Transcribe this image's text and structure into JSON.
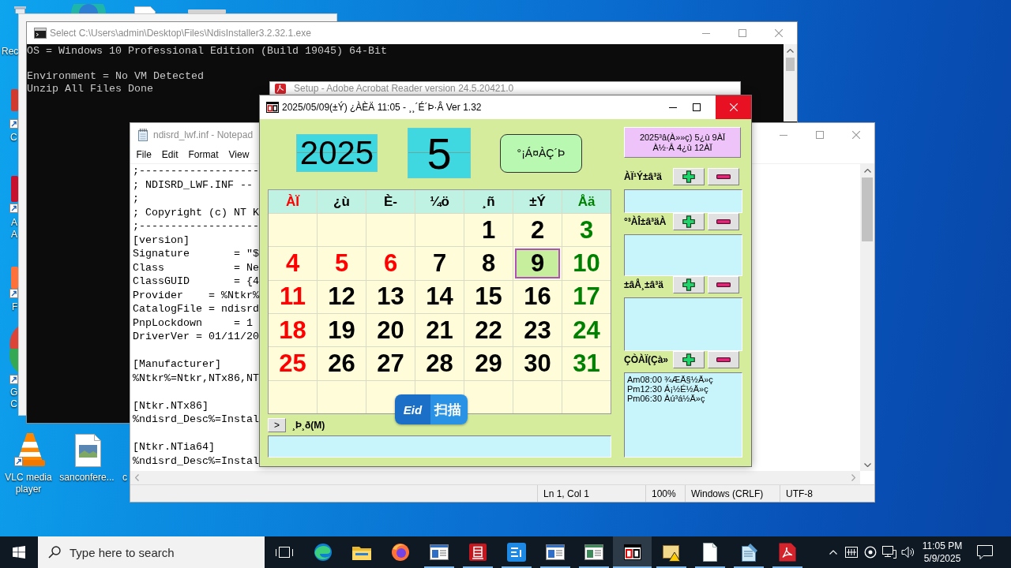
{
  "desktop": {
    "icons": [
      {
        "label": "Rec"
      },
      {
        "label": "C"
      },
      {
        "label": "A A"
      },
      {
        "label": "F"
      },
      {
        "label": "G C"
      },
      {
        "label": "VLC media player"
      },
      {
        "label": "sanconfere..."
      },
      {
        "label": "c"
      }
    ]
  },
  "console": {
    "title": "Select C:\\Users\\admin\\Desktop\\Files\\NdisInstaller3.2.32.1.exe",
    "active": false,
    "paragraphs": [
      [
        "OS = Windows 10 Professional Edition (Build 19045) 64-Bit"
      ],
      [
        "Environment = No VM Detected",
        "Unzip All Files Done"
      ]
    ]
  },
  "installer": {
    "title": "Setup - Adobe Acrobat Reader version 24.5.20421.0",
    "active": false
  },
  "notepad": {
    "title": "ndisrd_lwf.inf - Notepad",
    "active": false,
    "menu": [
      "File",
      "Edit",
      "Format",
      "View"
    ],
    "paragraphs": [
      [
        ";-------------------",
        "; NDISRD_LWF.INF --",
        ";",
        "; Copyright (c) NT K",
        ";-------------------",
        "[version]",
        "Signature       = \"$",
        "Class           = Ne",
        "ClassGUID       = {4",
        "Provider    = %Ntkr%",
        "CatalogFile = ndisrd",
        "PnpLockdown     = 1",
        "DriverVer = 01/11/20"
      ],
      [
        "[Manufacturer]",
        "%Ntkr%=Ntkr,NTx86,NT"
      ],
      [
        "[Ntkr.NTx86]",
        "%ndisrd_Desc%=Instal"
      ],
      [
        "[Ntkr.NTia64]",
        "%ndisrd_Desc%=Instal"
      ]
    ],
    "status": [
      "Ln 1, Col 1",
      "100%",
      "Windows (CRLF)",
      "UTF-8"
    ]
  },
  "calendar": {
    "title": "2025/05/09(±Ý) ¿ÀÈÄ 11:05 - ¸¸´É´Þ·Â Ver 1.32",
    "active": true,
    "close_highlighted": true,
    "year": "2025",
    "month": "5",
    "month_button": "°¡Á¤ÀÇ´Þ",
    "weekdays": [
      {
        "label": "ÀÏ",
        "color": "#ff0000"
      },
      {
        "label": "¿ù",
        "color": "#000000"
      },
      {
        "label": "È-",
        "color": "#000000"
      },
      {
        "label": "¼ö",
        "color": "#000000"
      },
      {
        "label": "¸ñ",
        "color": "#000000"
      },
      {
        "label": "±Ý",
        "color": "#000000"
      },
      {
        "label": "Åä",
        "color": "#008000"
      }
    ],
    "weeks": [
      [
        {
          "day": "1",
          "kind": "weekday",
          "selected": false
        },
        {
          "day": "2",
          "kind": "weekday",
          "selected": false
        },
        {
          "day": "3",
          "kind": "saturday",
          "selected": false
        }
      ],
      [
        {
          "day": "4",
          "kind": "holiday",
          "selected": false
        },
        {
          "day": "5",
          "kind": "holiday",
          "selected": false
        },
        {
          "day": "6",
          "kind": "holiday",
          "selected": false
        },
        {
          "day": "7",
          "kind": "weekday",
          "selected": false
        },
        {
          "day": "8",
          "kind": "weekday",
          "selected": false
        },
        {
          "day": "9",
          "kind": "weekday",
          "selected": true
        },
        {
          "day": "10",
          "kind": "saturday",
          "selected": false
        }
      ],
      [
        {
          "day": "11",
          "kind": "holiday",
          "selected": false
        },
        {
          "day": "12",
          "kind": "weekday",
          "selected": false
        },
        {
          "day": "13",
          "kind": "weekday",
          "selected": false
        },
        {
          "day": "14",
          "kind": "weekday",
          "selected": false
        },
        {
          "day": "15",
          "kind": "weekday",
          "selected": false
        },
        {
          "day": "16",
          "kind": "weekday",
          "selected": false
        },
        {
          "day": "17",
          "kind": "saturday",
          "selected": false
        }
      ],
      [
        {
          "day": "18",
          "kind": "holiday",
          "selected": false
        },
        {
          "day": "19",
          "kind": "weekday",
          "selected": false
        },
        {
          "day": "20",
          "kind": "weekday",
          "selected": false
        },
        {
          "day": "21",
          "kind": "weekday",
          "selected": false
        },
        {
          "day": "22",
          "kind": "weekday",
          "selected": false
        },
        {
          "day": "23",
          "kind": "weekday",
          "selected": false
        },
        {
          "day": "24",
          "kind": "saturday",
          "selected": false
        }
      ],
      [
        {
          "day": "25",
          "kind": "holiday",
          "selected": false
        },
        {
          "day": "26",
          "kind": "weekday",
          "selected": false
        },
        {
          "day": "27",
          "kind": "weekday",
          "selected": false
        },
        {
          "day": "28",
          "kind": "weekday",
          "selected": false
        },
        {
          "day": "29",
          "kind": "weekday",
          "selected": false
        },
        {
          "day": "30",
          "kind": "weekday",
          "selected": false
        },
        {
          "day": "31",
          "kind": "saturday",
          "selected": false
        }
      ]
    ],
    "memo": {
      "toggle": ">",
      "label": "¸Þ¸ð(M)"
    },
    "date_info": [
      "2025³â(À»»ç) 5¿ù 9ÀÏ",
      "À½·Â 4¿ù 12ÀÏ"
    ],
    "sections": [
      {
        "label": "ÀÏ¹Ý±â³ä"
      },
      {
        "label": "°³ÀÎ±â³äÀ"
      },
      {
        "label": "±âÅ¸±â³ä"
      },
      {
        "label": "ÇÒÀÏ(Çà»",
        "entries": [
          "Am08:00 ¾ÆÄ§½Ä»ç",
          "Pm12:30 Á¡½É½Ä»ç",
          "Pm06:30 Àú³á½Ä»ç"
        ]
      }
    ]
  },
  "scan_button": {
    "logo": "Eid",
    "label": "扫描"
  },
  "taskbar": {
    "search": {
      "placeholder": "Type here to search"
    },
    "apps": [
      {
        "running": false,
        "active": false
      },
      {
        "running": false,
        "active": false
      },
      {
        "running": false,
        "active": false
      },
      {
        "running": true,
        "active": false
      },
      {
        "running": true,
        "active": false
      },
      {
        "running": true,
        "active": false
      },
      {
        "running": true,
        "active": false
      },
      {
        "running": true,
        "active": false
      },
      {
        "running": true,
        "active": true
      },
      {
        "running": true,
        "active": false
      },
      {
        "running": true,
        "active": false
      },
      {
        "running": true,
        "active": false
      },
      {
        "running": true,
        "active": false
      }
    ],
    "clock": {
      "time": "11:05 PM",
      "date": "5/9/2025"
    }
  }
}
